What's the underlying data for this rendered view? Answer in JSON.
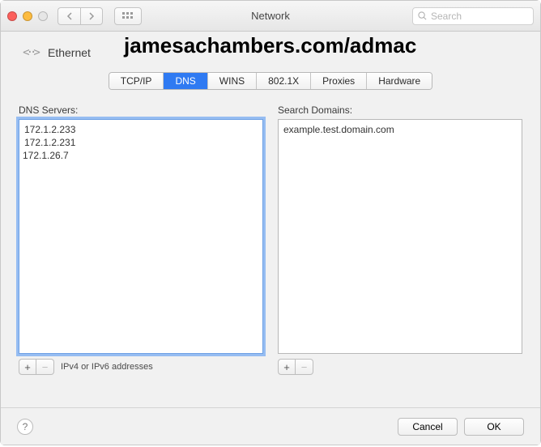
{
  "titlebar": {
    "title": "Network",
    "search_placeholder": "Search"
  },
  "header": {
    "connection_label": "Ethernet",
    "overlay_text": "jamesachambers.com/admac"
  },
  "tabs": [
    "TCP/IP",
    "DNS",
    "WINS",
    "802.1X",
    "Proxies",
    "Hardware"
  ],
  "active_tab": 1,
  "dns": {
    "servers_label": "DNS Servers:",
    "servers": [
      "172.1.2.233",
      "172.1.2.231",
      "172.1.26.7"
    ],
    "hint": "IPv4 or IPv6 addresses",
    "domains_label": "Search Domains:",
    "domains": [
      "example.test.domain.com"
    ]
  },
  "footer": {
    "cancel": "Cancel",
    "ok": "OK"
  },
  "glyphs": {
    "plus": "+",
    "minus": "−",
    "help": "?"
  }
}
